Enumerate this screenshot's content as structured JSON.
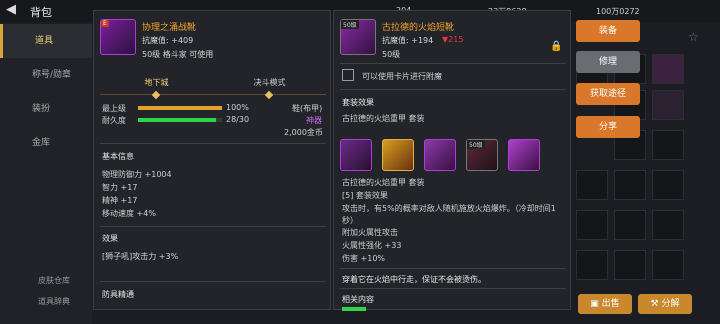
{
  "topbar": {
    "back_label": "背包",
    "currency_1": "204",
    "currency_2": "23万8628",
    "currency_3": "100万0272"
  },
  "nav": {
    "items": [
      {
        "label": "道具"
      },
      {
        "label": "称号/勋章"
      },
      {
        "label": "装扮"
      },
      {
        "label": "金库"
      }
    ],
    "bottom": [
      "皮肤仓库",
      "道具辞典"
    ]
  },
  "left_panel": {
    "badge": "E",
    "name": "协理之涌战靴",
    "resist": "抗魔值: +409",
    "info": "50级 格斗家 可使用",
    "tabs": [
      "地下城",
      "决斗模式"
    ],
    "max_level_label": "最上级",
    "max_level_value": "100%",
    "max_level_fraction": 1.0,
    "durability_label": "耐久度",
    "durability_value": "28/30",
    "durability_fraction": 0.933,
    "type_label": "鞋(布甲)",
    "rarity_label": "神器",
    "price": "2,000金币",
    "basic_info_title": "基本信息",
    "stats": [
      "物理防御力 +1004",
      "智力 +17",
      "精神 +17",
      "移动速度 +4%"
    ],
    "effect_title": "效果",
    "effect_text": "[狮子吼]攻击力 +3%",
    "mastery_title": "防具精通"
  },
  "right_panel": {
    "level_badge": "50级",
    "name": "古拉德的火焰短靴",
    "resist": "抗魔值: +194",
    "resist_diff": "▼215",
    "level": "50级",
    "card_label": "可以使用卡片进行附魔",
    "set_title": "套装效果",
    "set_name": "古拉德的火焰重甲  套装",
    "set_icon_level": "50级",
    "set_name_2": "古拉德的火焰重甲  套装",
    "set_count": "[5] 套装效果",
    "set_desc": "攻击时，有5%的概率对敌人随机施放火焰爆炸。（冷却时间1秒）",
    "attr_1": "附加火属性攻击",
    "attr_2": "火属性强化 +33",
    "attr_3": "伤害 +10%",
    "flavor": "穿着它在火焰中行走，保证不会被烫伤。",
    "related_title": "相关内容"
  },
  "actions": {
    "equip": "装备",
    "repair": "修理",
    "obtain": "获取途径",
    "share": "分享",
    "sell": "出售",
    "disassemble": "分解"
  },
  "colors": {
    "accent_orange": "#d9782a",
    "legend_orange": "#f0a42c",
    "purple": "#c66cf0",
    "green_bar": "#2fd44c",
    "gold_bar": "#e0a22c"
  }
}
